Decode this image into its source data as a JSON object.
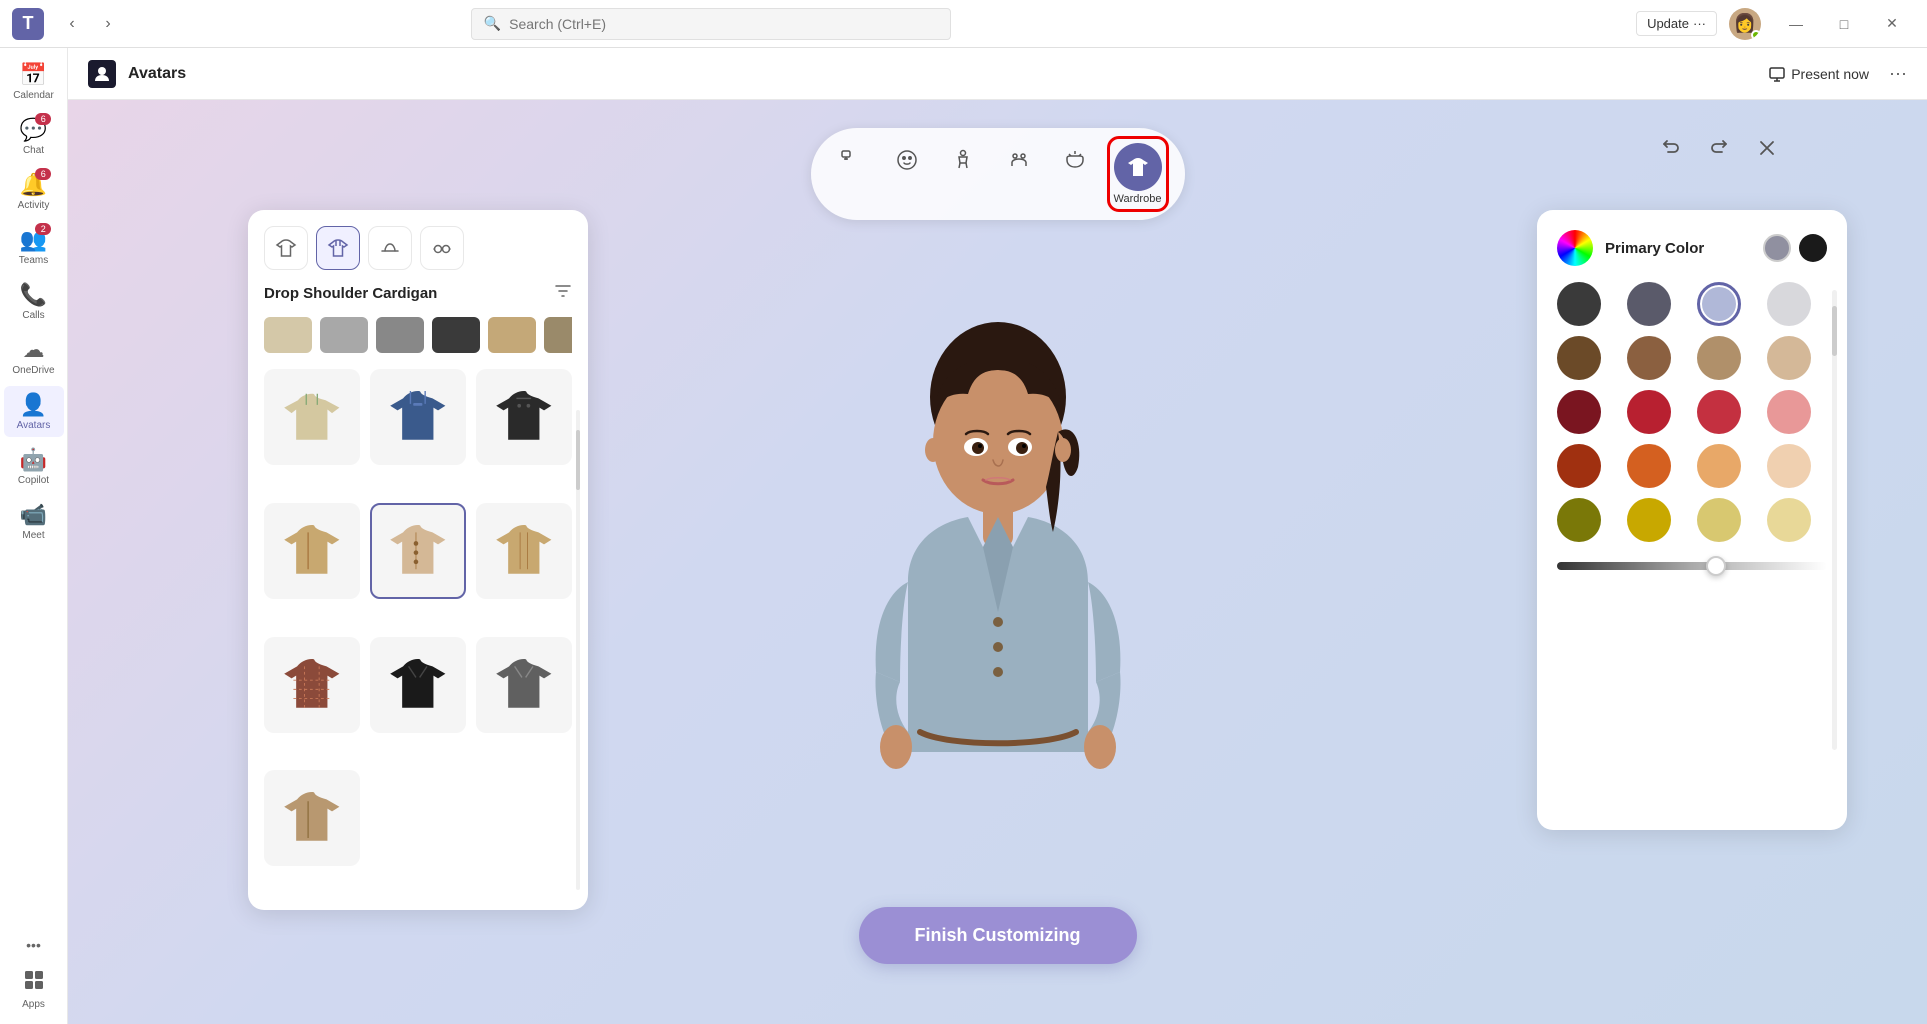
{
  "titlebar": {
    "logo": "T",
    "search_placeholder": "Search (Ctrl+E)",
    "update_label": "Update",
    "more_label": "···",
    "minimize": "—",
    "maximize": "□",
    "close": "✕"
  },
  "app_header": {
    "icon": "🎭",
    "title": "Avatars",
    "present_now": "Present now",
    "more": "···"
  },
  "sidebar": {
    "items": [
      {
        "id": "calendar",
        "label": "Calendar",
        "icon": "📅",
        "badge": null
      },
      {
        "id": "chat",
        "label": "Chat",
        "icon": "💬",
        "badge": "6"
      },
      {
        "id": "activity",
        "label": "Activity",
        "icon": "🔔",
        "badge": "6"
      },
      {
        "id": "teams",
        "label": "Teams",
        "icon": "👥",
        "badge": "2"
      },
      {
        "id": "calls",
        "label": "Calls",
        "icon": "📞",
        "badge": null
      },
      {
        "id": "onedrive",
        "label": "OneDrive",
        "icon": "☁",
        "badge": null
      },
      {
        "id": "avatars",
        "label": "Avatars",
        "icon": "👤",
        "badge": null
      },
      {
        "id": "copilot",
        "label": "Copilot",
        "icon": "🤖",
        "badge": null
      },
      {
        "id": "meet",
        "label": "Meet",
        "icon": "📹",
        "badge": null
      },
      {
        "id": "more",
        "label": "···",
        "icon": "···",
        "badge": null
      },
      {
        "id": "apps",
        "label": "Apps",
        "icon": "⊞",
        "badge": null
      }
    ]
  },
  "toolbar": {
    "buttons": [
      {
        "id": "reactions",
        "icon": "💬",
        "label": ""
      },
      {
        "id": "face",
        "icon": "😊",
        "label": ""
      },
      {
        "id": "body",
        "icon": "🧍",
        "label": ""
      },
      {
        "id": "gestures",
        "icon": "👫",
        "label": ""
      },
      {
        "id": "accessories",
        "icon": "🧴",
        "label": ""
      },
      {
        "id": "wardrobe",
        "icon": "👕",
        "label": "Wardrobe",
        "active": true
      }
    ]
  },
  "wardrobe": {
    "section_title": "Drop Shoulder Cardigan",
    "tabs": [
      "shirt",
      "jacket",
      "hat",
      "glasses"
    ],
    "colors_row": [
      "beige",
      "gray-light",
      "gray",
      "dark",
      "tan",
      "khaki"
    ],
    "items": [
      {
        "id": 1,
        "type": "hoodie",
        "color": "#d4c5a0",
        "selected": false
      },
      {
        "id": 2,
        "type": "jacket-blue",
        "color": "#3a5a8c",
        "selected": false
      },
      {
        "id": 3,
        "type": "jacket-black",
        "color": "#2a2a2a",
        "selected": false
      },
      {
        "id": 4,
        "type": "cardigan-tan",
        "color": "#c8a870",
        "selected": false
      },
      {
        "id": 5,
        "type": "cardigan-selected",
        "color": "#d4b896",
        "selected": true
      },
      {
        "id": 6,
        "type": "jacket-camel",
        "color": "#c8a870",
        "selected": false
      },
      {
        "id": 7,
        "type": "jacket-plaid",
        "color": "#8b4a4a",
        "selected": false
      },
      {
        "id": 8,
        "type": "blazer-black",
        "color": "#1a1a1a",
        "selected": false
      },
      {
        "id": 9,
        "type": "blazer-gray",
        "color": "#606060",
        "selected": false
      },
      {
        "id": 10,
        "type": "jacket-tan2",
        "color": "#b89870",
        "selected": false
      }
    ]
  },
  "color_panel": {
    "title": "Primary Color",
    "selected_colors": [
      "#9090a0",
      "#1a1a1a"
    ],
    "swatches": [
      {
        "color": "#3a3a3a",
        "selected": false
      },
      {
        "color": "#5a5a6a",
        "selected": false
      },
      {
        "color": "#b0b8d8",
        "selected": true
      },
      {
        "color": "#d8d8dc",
        "selected": false
      },
      {
        "color": "#6b4a28",
        "selected": false
      },
      {
        "color": "#8b6040",
        "selected": false
      },
      {
        "color": "#b0906a",
        "selected": false
      },
      {
        "color": "#d4b898",
        "selected": false
      },
      {
        "color": "#7a1520",
        "selected": false
      },
      {
        "color": "#b82030",
        "selected": false
      },
      {
        "color": "#c43040",
        "selected": false
      },
      {
        "color": "#e89898",
        "selected": false
      },
      {
        "color": "#a03010",
        "selected": false
      },
      {
        "color": "#d46020",
        "selected": false
      },
      {
        "color": "#e8a868",
        "selected": false
      },
      {
        "color": "#f0d0b0",
        "selected": false
      },
      {
        "color": "#7a7808",
        "selected": false
      },
      {
        "color": "#c8a800",
        "selected": false
      },
      {
        "color": "#d8c870",
        "selected": false
      },
      {
        "color": "#e8d898",
        "selected": false
      }
    ],
    "brightness": 60
  },
  "finish_button": {
    "label": "Finish Customizing"
  }
}
